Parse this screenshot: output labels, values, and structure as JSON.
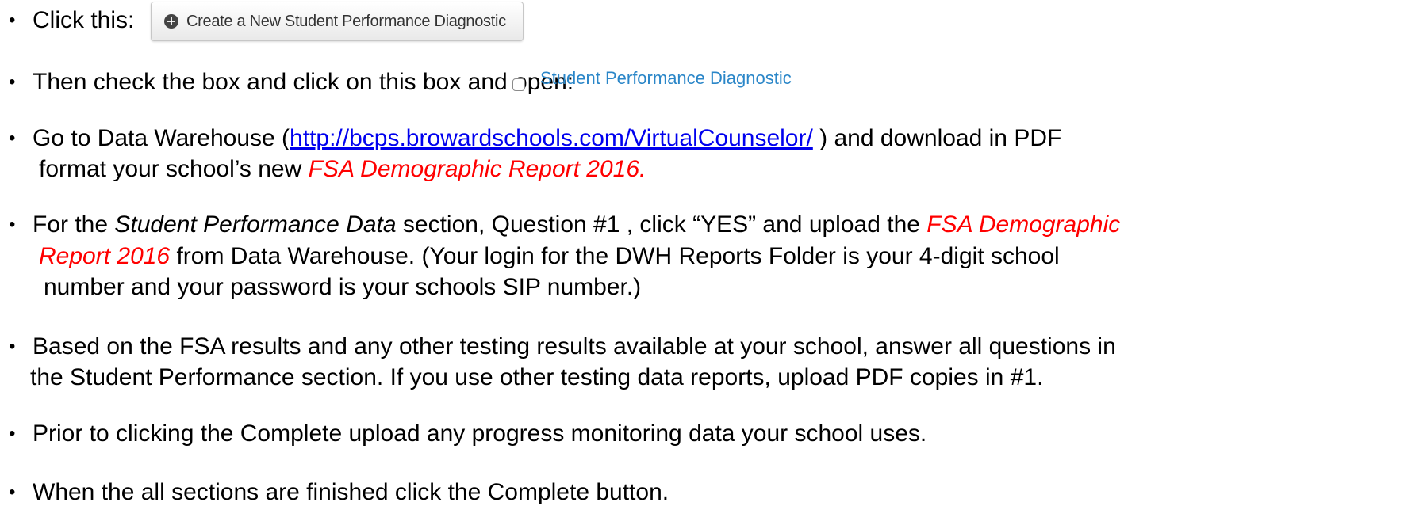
{
  "bullet": "•",
  "b1": {
    "prefix": "Click this:",
    "button_label": "Create a New Student Performance Diagnostic",
    "button_icon": "plus-circle-icon"
  },
  "b2": {
    "text": "Then check the box and click on this box and open:",
    "link_label": "Student Performance Diagnostic",
    "link_color": "#2a86c8"
  },
  "b3": {
    "pre": "Go to Data Warehouse (",
    "url": "http://bcps.browardschools.com/VirtualCounselor/",
    "post": " ) and download in PDF",
    "line2_pre": "format your school’s new ",
    "line2_red": "FSA Demographic Report 2016."
  },
  "b4": {
    "pre": "For the ",
    "ital": "Student Performance Data",
    "mid": " section, Question #1 , click “YES” and upload the ",
    "red1": "FSA Demographic",
    "line2_red": "Report 2016",
    "line2_post": " from Data Warehouse. (Your login for the DWH Reports Folder is your 4-digit school",
    "line3": "number and your password is your schools SIP number.)"
  },
  "b5": {
    "line1": "Based on the FSA results and any other testing results available at your school, answer all questions in",
    "line2": "the Student Performance section.  If you use other testing data reports, upload PDF copies in #1."
  },
  "b6": {
    "text": "Prior to clicking the Complete upload any progress monitoring data your school uses."
  },
  "b7": {
    "text": "When the all sections are finished click the Complete button."
  },
  "colors": {
    "highlight_red": "#ff0000",
    "link_blue": "#0000ee"
  }
}
